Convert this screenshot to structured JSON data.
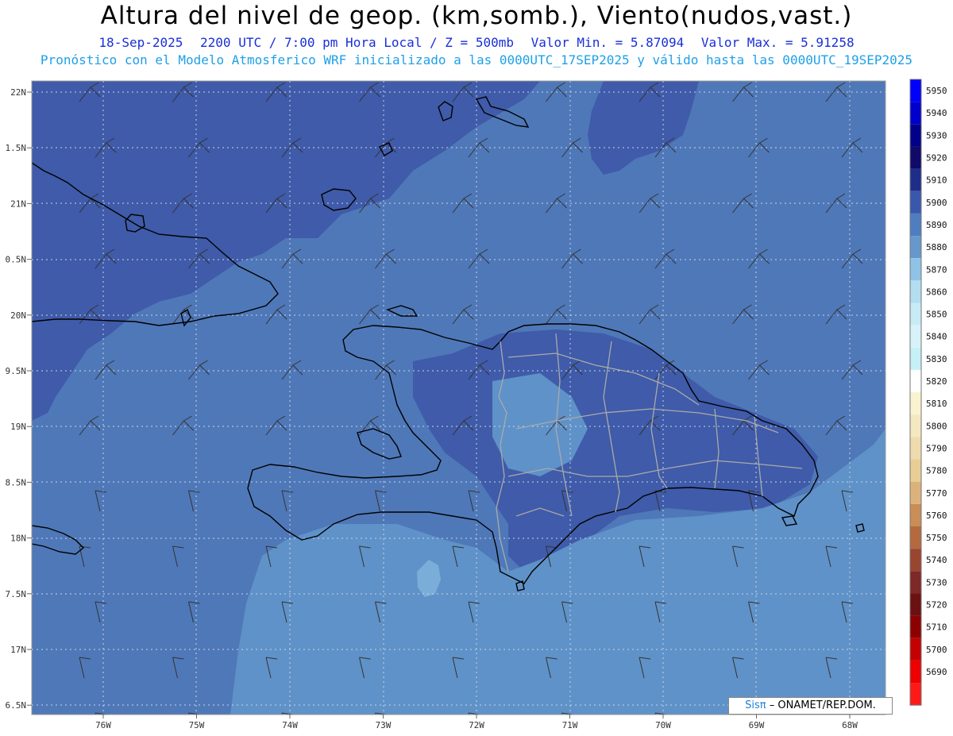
{
  "header": {
    "title": "Altura del nivel de geop. (km,somb.), Viento(nudos,vast.)",
    "date": "18-Sep-2025",
    "time": "2200 UTC / 7:00 pm Hora Local / Z = 500mb",
    "min": "Valor Min. = 5.87094",
    "max": "Valor Max. = 5.91258",
    "info": "Pronóstico con el Modelo Atmosferico WRF inicializado a las 0000UTC_17SEP2025 y válido hasta las  0000UTC_19SEP2025"
  },
  "map": {
    "lat_labels": [
      "22N",
      "1.5N",
      "21N",
      "0.5N",
      "20N",
      "9.5N",
      "19N",
      "8.5N",
      "18N",
      "7.5N",
      "17N",
      "6.5N"
    ],
    "lon_labels": [
      "76W",
      "75W",
      "74W",
      "73W",
      "72W",
      "71W",
      "70W",
      "69W",
      "68W"
    ],
    "colors": {
      "dark_field": "#3f5ba9",
      "mid_field": "#4f78b8",
      "light_field": "#5f92c8",
      "lighter_field": "#7aaed9",
      "coast": "#000000",
      "province_border": "#aaaaaa"
    }
  },
  "colorbar": {
    "levels": [
      {
        "value": "5950",
        "color": "#0000ff"
      },
      {
        "value": "5940",
        "color": "#0000cd"
      },
      {
        "value": "5930",
        "color": "#00008b"
      },
      {
        "value": "5920",
        "color": "#100a6a"
      },
      {
        "value": "5910",
        "color": "#1f2d8a"
      },
      {
        "value": "5900",
        "color": "#3a58ab"
      },
      {
        "value": "5890",
        "color": "#4f7ec0"
      },
      {
        "value": "5880",
        "color": "#6798cc"
      },
      {
        "value": "5870",
        "color": "#8ec3e6"
      },
      {
        "value": "5860",
        "color": "#b2def0"
      },
      {
        "value": "5850",
        "color": "#c8ecf6"
      },
      {
        "value": "5840",
        "color": "#d8f2f9"
      },
      {
        "value": "5830",
        "color": "#c6f0f8"
      },
      {
        "value": "5820",
        "color": "#ffffff"
      },
      {
        "value": "5810",
        "color": "#faf3cf"
      },
      {
        "value": "5800",
        "color": "#f4e8c1"
      },
      {
        "value": "5790",
        "color": "#efdcae"
      },
      {
        "value": "5780",
        "color": "#e8cd96"
      },
      {
        "value": "5770",
        "color": "#dcb27c"
      },
      {
        "value": "5760",
        "color": "#c98d58"
      },
      {
        "value": "5750",
        "color": "#b46a3e"
      },
      {
        "value": "5740",
        "color": "#9a4530"
      },
      {
        "value": "5730",
        "color": "#7e2828"
      },
      {
        "value": "5720",
        "color": "#6b1111"
      },
      {
        "value": "5710",
        "color": "#8e0000"
      },
      {
        "value": "5700",
        "color": "#c40000"
      },
      {
        "value": "5690",
        "color": "#ee0000"
      },
      {
        "value": "",
        "color": "#ff1a1a"
      }
    ]
  },
  "credit": {
    "sis": "Sisπ",
    "org": "– ONAMET/REP.DOM."
  }
}
